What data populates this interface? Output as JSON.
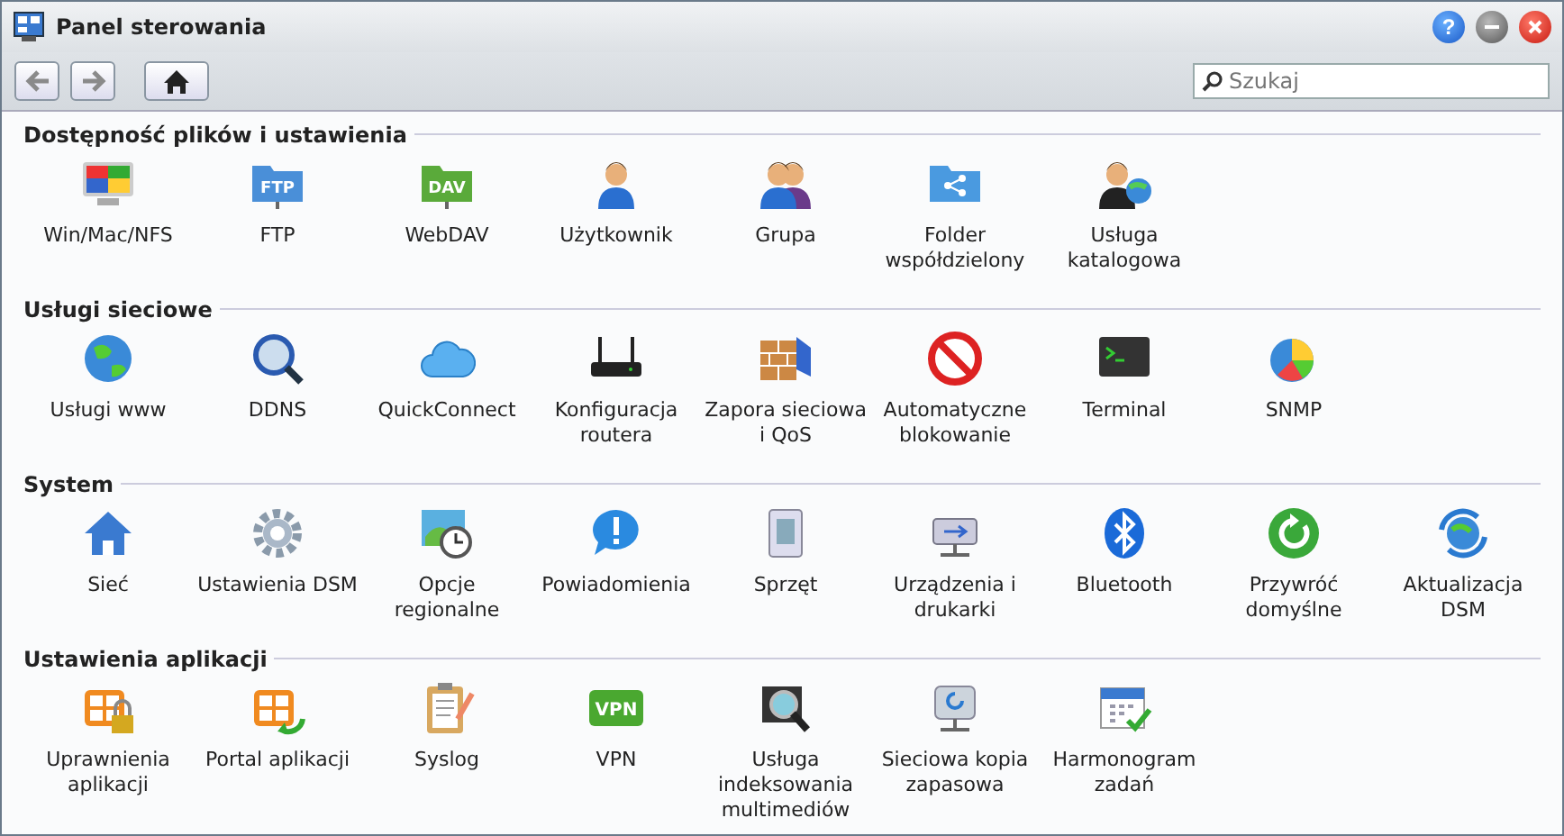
{
  "window": {
    "title": "Panel sterowania",
    "help": "?"
  },
  "search": {
    "placeholder": "Szukaj"
  },
  "sections": [
    {
      "title": "Dostępność plików i ustawienia",
      "items": [
        {
          "label": "Win/Mac/NFS"
        },
        {
          "label": "FTP",
          "icon_text": "FTP"
        },
        {
          "label": "WebDAV",
          "icon_text": "DAV"
        },
        {
          "label": "Użytkownik"
        },
        {
          "label": "Grupa"
        },
        {
          "label": "Folder współdzielony"
        },
        {
          "label": "Usługa katalogowa"
        }
      ]
    },
    {
      "title": "Usługi sieciowe",
      "items": [
        {
          "label": "Usługi www"
        },
        {
          "label": "DDNS"
        },
        {
          "label": "QuickConnect"
        },
        {
          "label": "Konfiguracja routera"
        },
        {
          "label": "Zapora sieciowa i QoS"
        },
        {
          "label": "Automatyczne blokowanie"
        },
        {
          "label": "Terminal"
        },
        {
          "label": "SNMP"
        }
      ]
    },
    {
      "title": "System",
      "items": [
        {
          "label": "Sieć"
        },
        {
          "label": "Ustawienia DSM"
        },
        {
          "label": "Opcje regionalne"
        },
        {
          "label": "Powiadomienia"
        },
        {
          "label": "Sprzęt"
        },
        {
          "label": "Urządzenia i drukarki"
        },
        {
          "label": "Bluetooth"
        },
        {
          "label": "Przywróć domyślne"
        },
        {
          "label": "Aktualizacja DSM"
        }
      ]
    },
    {
      "title": "Ustawienia aplikacji",
      "items": [
        {
          "label": "Uprawnienia aplikacji"
        },
        {
          "label": "Portal aplikacji"
        },
        {
          "label": "Syslog"
        },
        {
          "label": "VPN",
          "icon_text": "VPN"
        },
        {
          "label": "Usługa indeksowania multimediów"
        },
        {
          "label": "Sieciowa kopia zapasowa"
        },
        {
          "label": "Harmonogram zadań"
        }
      ]
    }
  ]
}
